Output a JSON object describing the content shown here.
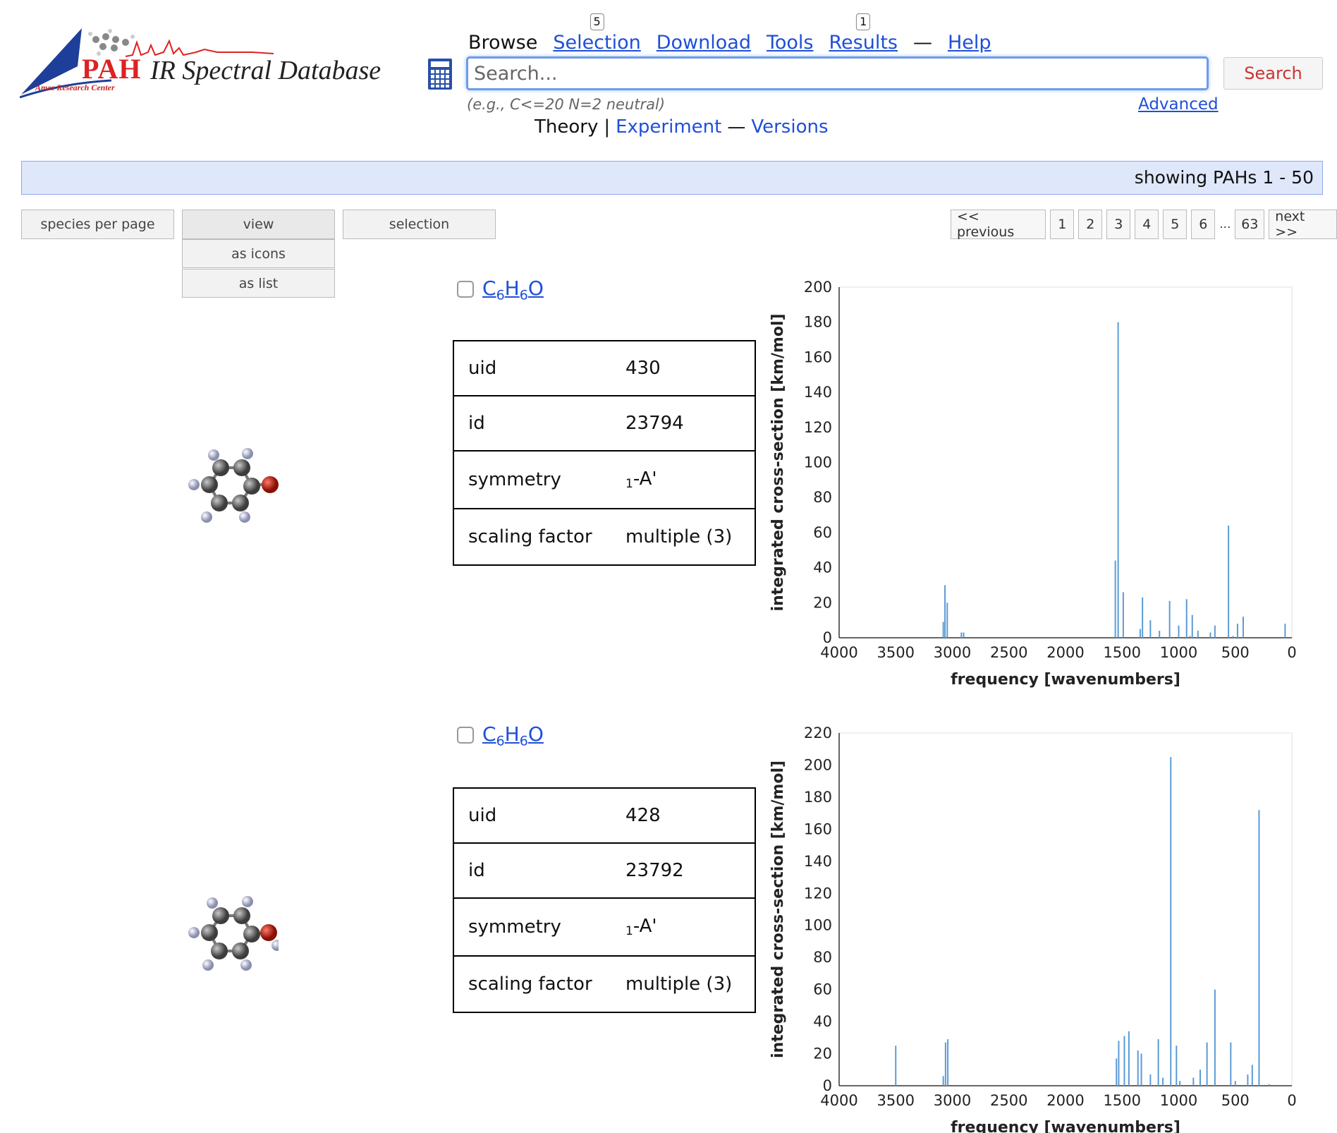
{
  "header": {
    "logo_pah": "PAH",
    "logo_rest": "IR Spectral Database",
    "logo_ames": "Ames Research Center"
  },
  "nav": {
    "browse": "Browse",
    "selection": "Selection",
    "selection_badge": "5",
    "download": "Download",
    "tools": "Tools",
    "results": "Results",
    "results_badge": "1",
    "dash": "—",
    "help": "Help"
  },
  "search": {
    "placeholder": "Search...",
    "button": "Search",
    "hint": "(e.g., C<=20 N=2 neutral)",
    "advanced": "Advanced"
  },
  "subnav": {
    "theory": "Theory",
    "pipe": "|",
    "experiment": "Experiment",
    "dash": "—",
    "versions": "Versions"
  },
  "status": {
    "showing": "showing PAHs 1 - 50"
  },
  "toolbar": {
    "species_per_page": "species per page",
    "view": "view",
    "as_icons": "as icons",
    "as_list": "as list",
    "selection": "selection"
  },
  "pager": {
    "previous": "<< previous",
    "pages": [
      "1",
      "2",
      "3",
      "4",
      "5",
      "6"
    ],
    "ellipsis": "...",
    "last": "63",
    "next": "next >>"
  },
  "colors": {
    "link": "#1f4fd8",
    "bar": "#5b9bd5",
    "highlight_bar": "#dfe7fb"
  },
  "records": [
    {
      "formula": {
        "c": "C",
        "c_n": "6",
        "h": "H",
        "h_n": "6",
        "o": "O"
      },
      "labels": {
        "uid": "uid",
        "id": "id",
        "symmetry": "symmetry",
        "scaling": "scaling factor"
      },
      "uid": "430",
      "id": "23794",
      "symmetry_sub": "1",
      "symmetry_main": "-A'",
      "scaling": "multiple (3)"
    },
    {
      "formula": {
        "c": "C",
        "c_n": "6",
        "h": "H",
        "h_n": "6",
        "o": "O"
      },
      "labels": {
        "uid": "uid",
        "id": "id",
        "symmetry": "symmetry",
        "scaling": "scaling factor"
      },
      "uid": "428",
      "id": "23792",
      "symmetry_sub": "1",
      "symmetry_main": "-A'",
      "scaling": "multiple (3)"
    }
  ],
  "chart_data": [
    {
      "type": "bar",
      "xlabel": "frequency [wavenumbers]",
      "ylabel": "integrated cross-section [km/mol]",
      "xlim": [
        4000,
        0
      ],
      "ylim": [
        0,
        200
      ],
      "xticks": [
        4000,
        3500,
        3000,
        2500,
        2000,
        1500,
        1000,
        500,
        0
      ],
      "yticks": [
        0,
        20,
        40,
        60,
        80,
        100,
        120,
        140,
        160,
        180,
        200
      ],
      "x": [
        3080,
        3065,
        3045,
        2920,
        2900,
        1560,
        1535,
        1490,
        1340,
        1320,
        1250,
        1170,
        1080,
        1000,
        930,
        900,
        880,
        830,
        720,
        680,
        560,
        520,
        480,
        430,
        60
      ],
      "values": [
        9,
        30,
        20,
        3,
        3,
        44,
        180,
        26,
        5,
        23,
        10,
        4,
        21,
        7,
        22,
        1,
        13,
        4,
        3,
        7,
        64,
        1,
        8,
        12,
        8
      ]
    },
    {
      "type": "bar",
      "xlabel": "frequency [wavenumbers]",
      "ylabel": "integrated cross-section [km/mol]",
      "xlim": [
        4000,
        0
      ],
      "ylim": [
        0,
        220
      ],
      "xticks": [
        4000,
        3500,
        3000,
        2500,
        2000,
        1500,
        1000,
        500,
        0
      ],
      "yticks": [
        0,
        20,
        40,
        60,
        80,
        100,
        120,
        140,
        160,
        180,
        200,
        220
      ],
      "x": [
        3500,
        3080,
        3060,
        3040,
        1550,
        1530,
        1480,
        1440,
        1360,
        1330,
        1250,
        1180,
        1140,
        1070,
        1020,
        990,
        870,
        810,
        750,
        680,
        540,
        500,
        390,
        350,
        290,
        200
      ],
      "values": [
        25,
        6,
        27,
        29,
        17,
        28,
        31,
        34,
        22,
        20,
        7,
        29,
        5,
        205,
        25,
        3,
        5,
        10,
        27,
        60,
        27,
        3,
        7,
        13,
        172,
        1
      ]
    }
  ]
}
